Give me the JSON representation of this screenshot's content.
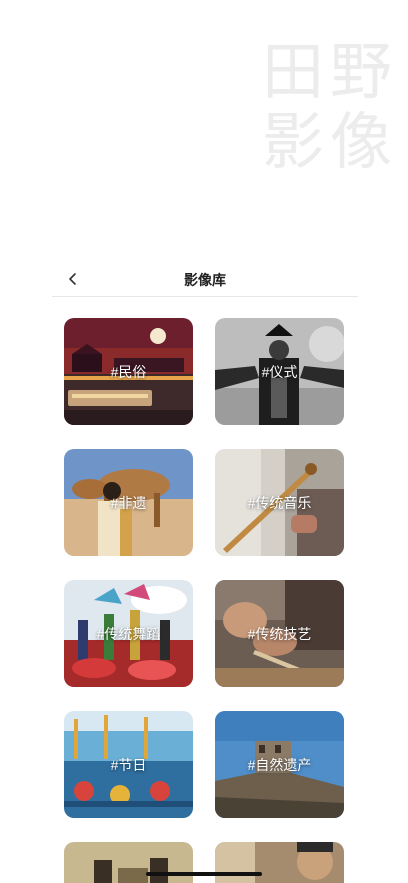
{
  "hero": {
    "line1": "田野",
    "line2": "影像"
  },
  "navbar": {
    "title": "影像库",
    "back_icon": "chevron-left-icon"
  },
  "categories": [
    {
      "tag": "#民俗"
    },
    {
      "tag": "#仪式"
    },
    {
      "tag": "#非遗"
    },
    {
      "tag": "#传统音乐"
    },
    {
      "tag": "#传统舞蹈"
    },
    {
      "tag": "#传统技艺"
    },
    {
      "tag": "#节日"
    },
    {
      "tag": "#自然遗产"
    }
  ],
  "colors": {
    "background": "#ffffff",
    "title_text": "#222222",
    "divider": "#e6e6e6",
    "watermark": "#ececec"
  }
}
